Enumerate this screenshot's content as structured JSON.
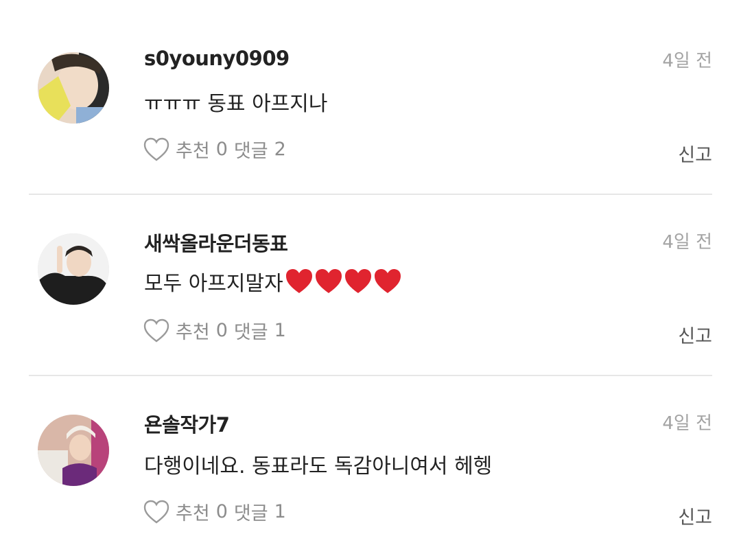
{
  "comments": [
    {
      "username": "s0youny0909",
      "time": "4일 전",
      "text": "ㅠㅠㅠ 동표 아프지나",
      "like_label": "추천",
      "like_count": "0",
      "reply_label": "댓글",
      "reply_count": "2",
      "report_label": "신고"
    },
    {
      "username": "새싹올라운더동표",
      "time": "4일 전",
      "text": "모두 아프지말자",
      "hearts": 4,
      "like_label": "추천",
      "like_count": "0",
      "reply_label": "댓글",
      "reply_count": "1",
      "report_label": "신고"
    },
    {
      "username": "욘솔작가7",
      "time": "4일 전",
      "text": "다행이네요. 동표라도 독감아니여서 헤헹",
      "like_label": "추천",
      "like_count": "0",
      "reply_label": "댓글",
      "reply_count": "1",
      "report_label": "신고"
    }
  ],
  "colors": {
    "heart": "#e0242f",
    "divider": "#e6e6e6",
    "muted": "#a3a3a3"
  }
}
